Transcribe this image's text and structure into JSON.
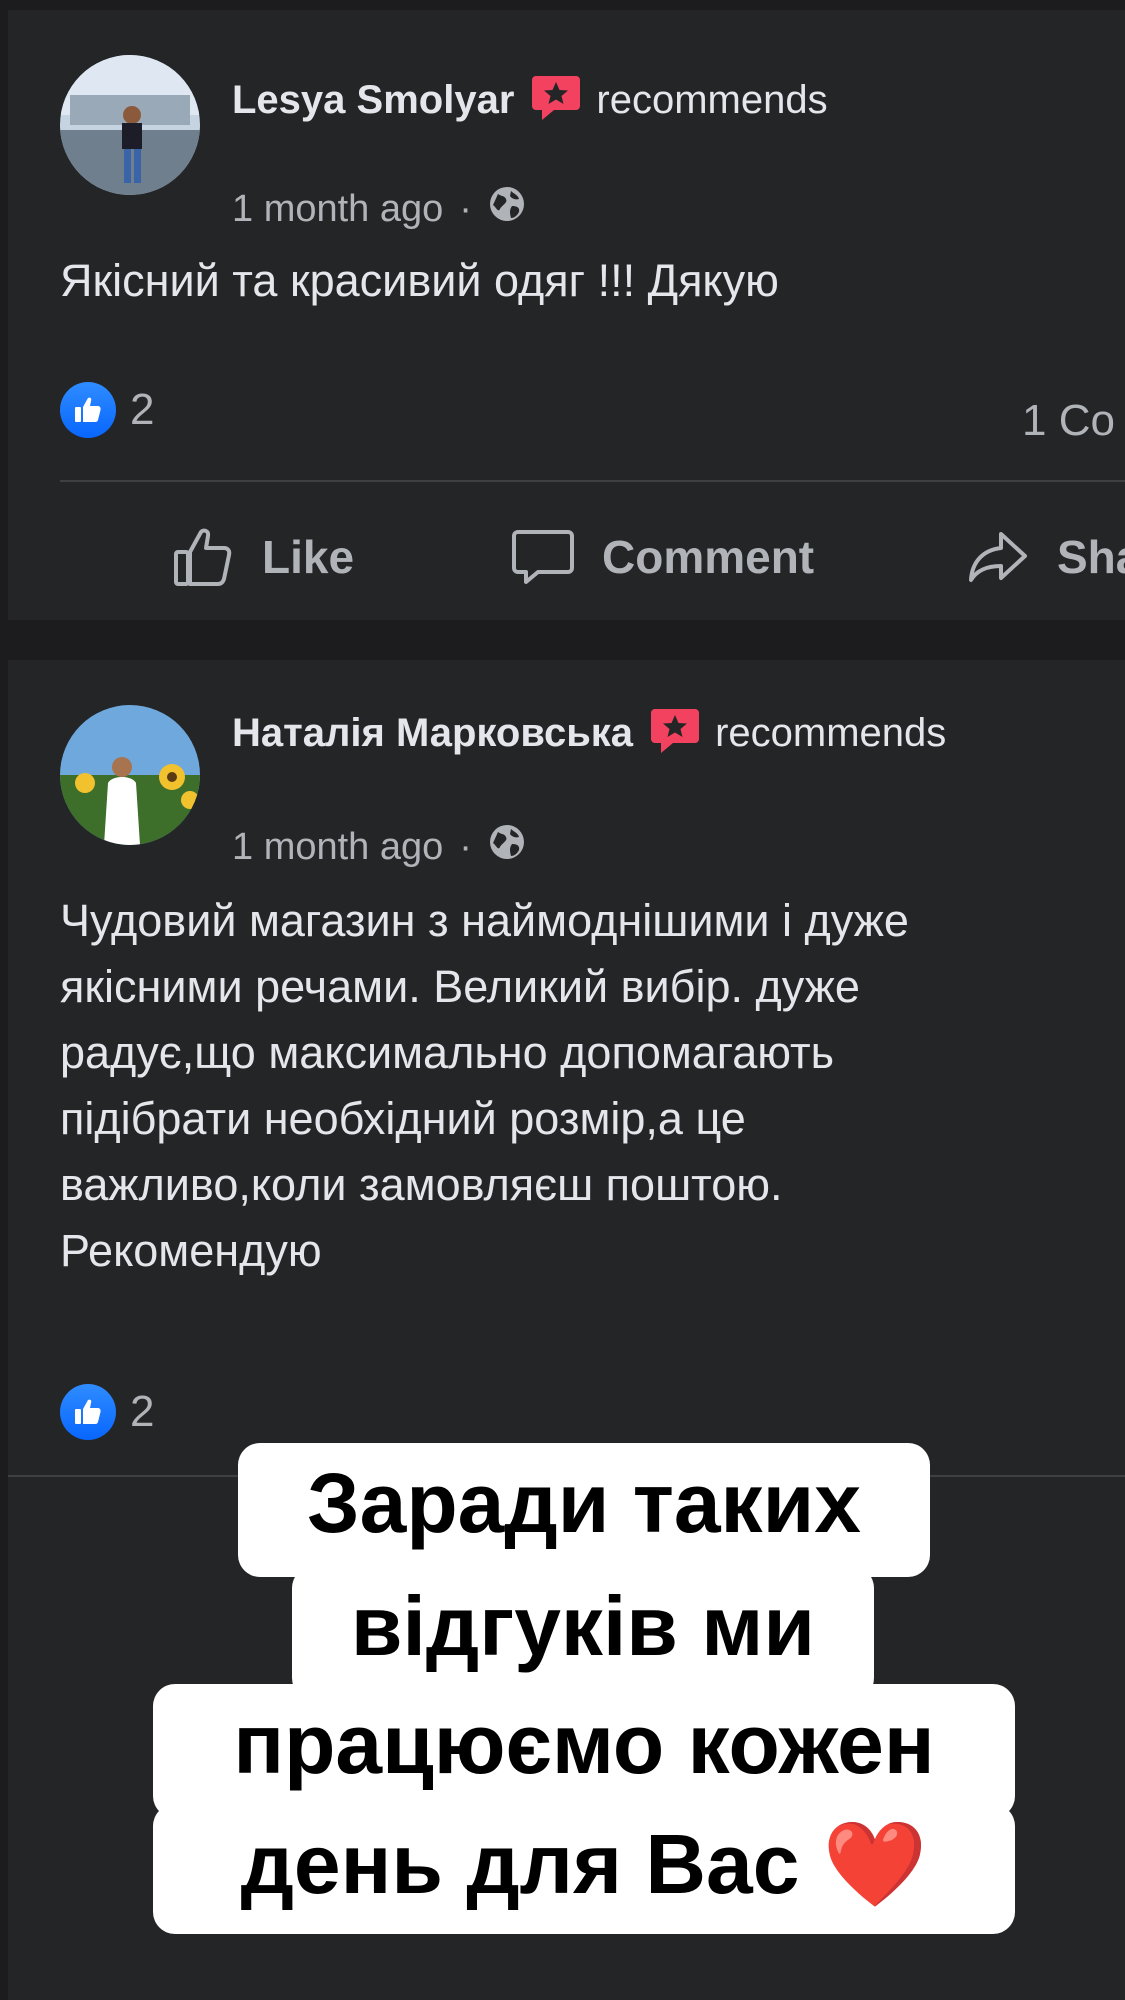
{
  "posts": [
    {
      "author": "Lesya Smolyar",
      "recommends": "recommends",
      "time": "1 month ago",
      "dot": "·",
      "text": "Якісний та красивий одяг !!! Дякую",
      "likes": "2",
      "comments": "1 Co"
    },
    {
      "author": "Наталія Марковська",
      "recommends": "recommends",
      "time": "1 month ago",
      "dot": "·",
      "text": "Чудовий магазин з наймоднішими і дуже\nякісними речами. Великий вибір. дуже\nрадує,що максимально допомагають\nпідібрати необхідний розмір,а це\nважливо,коли замовляєш поштою.\nРекомендую",
      "likes": "2"
    }
  ],
  "actions": {
    "like": "Like",
    "comment": "Comment",
    "share": "Sha"
  },
  "overlay": {
    "lines": [
      "Заради таких",
      "відгуків ми",
      "працюємо кожен",
      "день для Вас ❤️"
    ]
  },
  "colors": {
    "background": "#1c1c1e",
    "card": "#242526",
    "like_blue": "#0866ff",
    "recommend_red": "#f3425f"
  },
  "icons": [
    "globe-icon",
    "recommend-icon",
    "like-icon",
    "comment-icon",
    "share-icon"
  ]
}
